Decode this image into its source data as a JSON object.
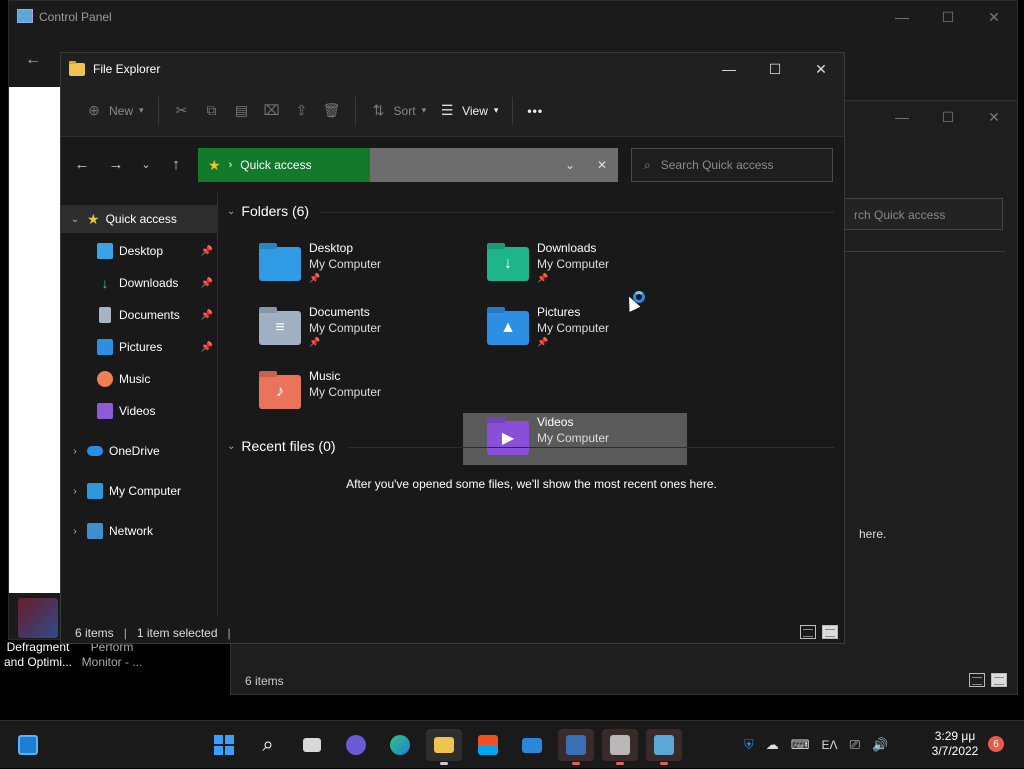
{
  "background_window": {
    "title": "Control Panel",
    "search_placeholder": "rch Quick access",
    "status": "6 items",
    "partial_text": "here."
  },
  "desktop_icons": [
    {
      "label_line1": "Defragment",
      "label_line2": "and Optimi..."
    },
    {
      "label_line1": "Perform",
      "label_line2": "Monitor - ..."
    }
  ],
  "window": {
    "title": "File Explorer",
    "controls": {
      "minimize": "—",
      "maximize": "☐",
      "close": "✕"
    }
  },
  "toolbar": {
    "new_label": "New",
    "sort_label": "Sort",
    "view_label": "View",
    "more_label": "•••"
  },
  "address": {
    "current": "Quick access",
    "search_placeholder": "Search Quick access"
  },
  "sidebar": {
    "quick_access": "Quick access",
    "items": [
      {
        "label": "Desktop",
        "pinned": true,
        "icon": "desktop-icon",
        "color": "#3aa3e8"
      },
      {
        "label": "Downloads",
        "pinned": true,
        "icon": "download-icon",
        "color": "#3ecb8c"
      },
      {
        "label": "Documents",
        "pinned": true,
        "icon": "documents-icon",
        "color": "#a7b4c3"
      },
      {
        "label": "Pictures",
        "pinned": true,
        "icon": "pictures-icon",
        "color": "#2c8fe0"
      },
      {
        "label": "Music",
        "pinned": false,
        "icon": "music-icon",
        "color": "#f07f55"
      },
      {
        "label": "Videos",
        "pinned": false,
        "icon": "videos-icon",
        "color": "#8b5cd6"
      }
    ],
    "roots": [
      {
        "label": "OneDrive",
        "icon": "cloud-icon"
      },
      {
        "label": "My Computer",
        "icon": "computer-icon"
      },
      {
        "label": "Network",
        "icon": "network-icon"
      }
    ]
  },
  "folders_header": "Folders (6)",
  "folders": [
    {
      "name": "Desktop",
      "location": "My Computer",
      "pinned": true,
      "color": "#2f9be5",
      "glyph": ""
    },
    {
      "name": "Downloads",
      "location": "My Computer",
      "pinned": true,
      "color": "#1fb58a",
      "glyph": "↓"
    },
    {
      "name": "Documents",
      "location": "My Computer",
      "pinned": true,
      "color": "#9fb0c2",
      "glyph": "≡"
    },
    {
      "name": "Pictures",
      "location": "My Computer",
      "pinned": true,
      "color": "#2d8fe4",
      "glyph": "▲"
    },
    {
      "name": "Music",
      "location": "My Computer",
      "pinned": false,
      "color": "#e9745a",
      "glyph": "♪"
    },
    {
      "name": "Videos",
      "location": "My Computer",
      "pinned": false,
      "color": "#8a4fd9",
      "glyph": "▶",
      "selected": true
    }
  ],
  "recent_header": "Recent files (0)",
  "recent_empty": "After you've opened some files, we'll show the most recent ones here.",
  "status": {
    "items": "6 items",
    "selected": "1 item selected"
  },
  "taskbar": {
    "language": "ΕΛ",
    "time": "3:29 μμ",
    "date": "3/7/2022",
    "notifications": "6"
  }
}
